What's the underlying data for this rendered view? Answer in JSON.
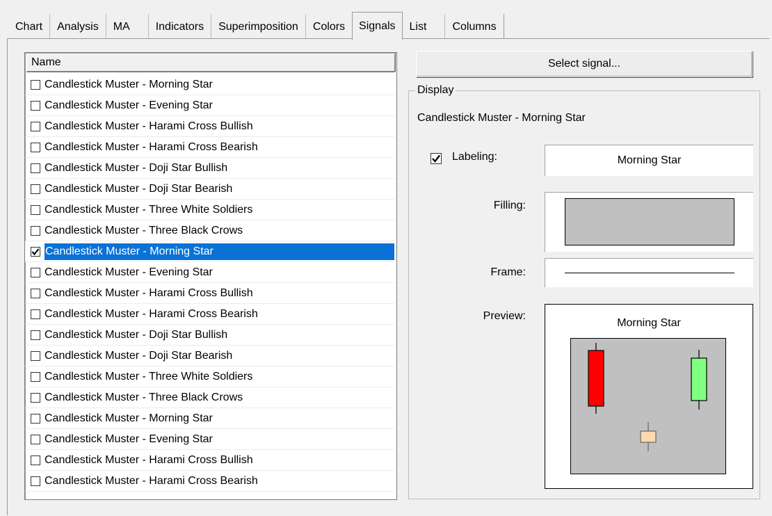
{
  "tabs": [
    {
      "label": "Chart"
    },
    {
      "label": "Analysis"
    },
    {
      "label": "MA"
    },
    {
      "label": "Indicators"
    },
    {
      "label": "Superimposition"
    },
    {
      "label": "Colors"
    },
    {
      "label": "Signals"
    },
    {
      "label": "List"
    },
    {
      "label": "Columns"
    }
  ],
  "active_tab": "Signals",
  "list": {
    "header": "Name",
    "rows": [
      {
        "label": "Candlestick Muster - Morning Star",
        "checked": false
      },
      {
        "label": "Candlestick Muster - Evening Star",
        "checked": false
      },
      {
        "label": "Candlestick Muster - Harami Cross Bullish",
        "checked": false
      },
      {
        "label": "Candlestick Muster - Harami Cross Bearish",
        "checked": false
      },
      {
        "label": "Candlestick Muster - Doji Star Bullish",
        "checked": false
      },
      {
        "label": "Candlestick Muster - Doji Star Bearish",
        "checked": false
      },
      {
        "label": "Candlestick Muster - Three White Soldiers",
        "checked": false
      },
      {
        "label": "Candlestick Muster - Three Black Crows",
        "checked": false
      },
      {
        "label": "Candlestick Muster - Morning Star",
        "checked": true,
        "selected": true
      },
      {
        "label": "Candlestick Muster - Evening Star",
        "checked": false
      },
      {
        "label": "Candlestick Muster - Harami Cross Bullish",
        "checked": false
      },
      {
        "label": "Candlestick Muster - Harami Cross Bearish",
        "checked": false
      },
      {
        "label": "Candlestick Muster - Doji Star Bullish",
        "checked": false
      },
      {
        "label": "Candlestick Muster - Doji Star Bearish",
        "checked": false
      },
      {
        "label": "Candlestick Muster - Three White Soldiers",
        "checked": false
      },
      {
        "label": "Candlestick Muster - Three Black Crows",
        "checked": false
      },
      {
        "label": "Candlestick Muster - Morning Star",
        "checked": false
      },
      {
        "label": "Candlestick Muster - Evening Star",
        "checked": false
      },
      {
        "label": "Candlestick Muster - Harami Cross Bullish",
        "checked": false
      },
      {
        "label": "Candlestick Muster - Harami Cross Bearish",
        "checked": false
      }
    ]
  },
  "select_signal_button": "Select signal...",
  "display": {
    "group_title": "Display",
    "selected_name": "Candlestick Muster - Morning Star",
    "labeling_label": "Labeling:",
    "labeling_checked": true,
    "labeling_value": "Morning Star",
    "filling_label": "Filling:",
    "filling_color": "#c0c0c0",
    "frame_label": "Frame:",
    "preview_label": "Preview:",
    "preview_title": "Morning Star",
    "preview_bg": "#c0c0c0",
    "candle_colors": {
      "bearish": "#ff0000",
      "doji": "#ffd8b0",
      "bullish": "#80ff80"
    }
  },
  "colors": {
    "selection": "#0a72d6"
  }
}
